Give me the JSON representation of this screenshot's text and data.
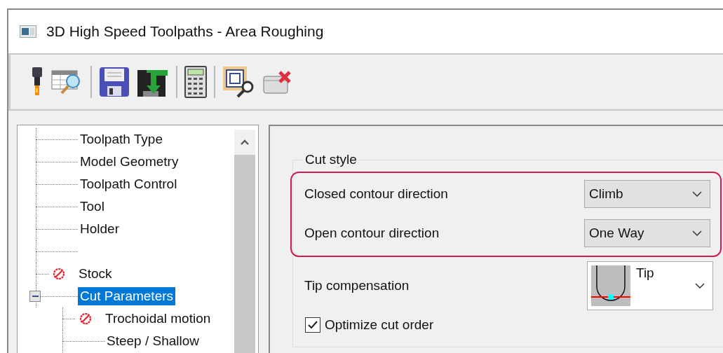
{
  "window": {
    "title": "3D High Speed Toolpaths - Area Roughing"
  },
  "toolbar": [
    {
      "kind": "cutter"
    },
    {
      "kind": "table-search"
    },
    {
      "kind": "separator"
    },
    {
      "kind": "save"
    },
    {
      "kind": "save-arrow"
    },
    {
      "kind": "separator"
    },
    {
      "kind": "calculator"
    },
    {
      "kind": "separator"
    },
    {
      "kind": "frame-search"
    },
    {
      "kind": "window-close"
    }
  ],
  "tree": [
    {
      "label": "Toolpath Type",
      "kind": "page",
      "warning": false,
      "selected": false
    },
    {
      "label": "Model Geometry",
      "kind": "page",
      "warning": false,
      "selected": false
    },
    {
      "label": "Toolpath Control",
      "kind": "page",
      "warning": false,
      "selected": false
    },
    {
      "label": "Tool",
      "kind": "page",
      "warning": false,
      "selected": false
    },
    {
      "label": "Holder",
      "kind": "page",
      "warning": false,
      "selected": false
    },
    {
      "kind": "blank"
    },
    {
      "label": "Stock",
      "kind": "page",
      "warning": true,
      "selected": false
    },
    {
      "label": "Cut Parameters",
      "kind": "page",
      "warning": false,
      "selected": true,
      "expanded": true,
      "children": [
        {
          "label": "Trochoidal motion",
          "kind": "page",
          "warning": true,
          "selected": false
        },
        {
          "label": "Steep / Shallow",
          "kind": "page",
          "warning": false,
          "selected": false
        }
      ]
    }
  ],
  "cut_style": {
    "title": "Cut style",
    "highlighted_rows": [
      {
        "label": "Closed contour direction",
        "value": "Climb"
      },
      {
        "label": "Open contour direction",
        "value": "One Way"
      }
    ],
    "tip_compensation": {
      "label": "Tip compensation",
      "value": "Tip"
    },
    "optimize_cut_order": {
      "label": "Optimize cut order",
      "checked": true
    }
  }
}
